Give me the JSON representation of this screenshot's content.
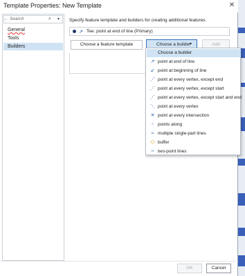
{
  "window": {
    "title": "Template Properties: New Template",
    "close_icon": "close-icon"
  },
  "sidebar": {
    "search_placeholder": "Search",
    "items": [
      {
        "label": "General",
        "active": false
      },
      {
        "label": "Tools",
        "active": false
      },
      {
        "label": "Builders",
        "active": true
      }
    ]
  },
  "main": {
    "description": "Specify feature template and builders for creating additional features.",
    "tee_label": "Tee: point at end of line (Primary)",
    "feature_template_label": "Choose a feature template",
    "builder_label": "Choose a builder",
    "add_label": "Add"
  },
  "dropdown": {
    "header": "Choose a builder",
    "items": [
      {
        "label": "point at end of line",
        "icon": "point-end-line-icon"
      },
      {
        "label": "point at beginning of line",
        "icon": "point-begin-line-icon"
      },
      {
        "label": "point at every vertex, except end",
        "icon": "vertex-except-end-icon"
      },
      {
        "label": "point at every vertex, except start",
        "icon": "vertex-except-start-icon"
      },
      {
        "label": "point at every vertex, except start and end",
        "icon": "vertex-except-start-end-icon"
      },
      {
        "label": "point at every vertex",
        "icon": "vertex-icon"
      },
      {
        "label": "point at every intersection",
        "icon": "intersection-icon"
      },
      {
        "label": "points along",
        "icon": "points-along-icon"
      },
      {
        "label": "multiple single-part lines",
        "icon": "multi-line-icon"
      },
      {
        "label": "buffer",
        "icon": "buffer-icon"
      },
      {
        "label": "two-point lines",
        "icon": "two-point-line-icon"
      }
    ]
  },
  "footer": {
    "ok_label": "OK",
    "cancel_label": "Cancel"
  },
  "colors": {
    "selection": "#cfe3f4",
    "accent": "#2d6db4"
  }
}
